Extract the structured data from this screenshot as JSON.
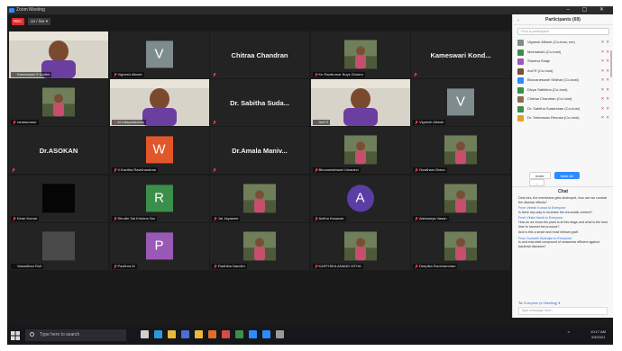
{
  "window": {
    "title": "Zoom Meeting",
    "buttons": "– ▢ ✕"
  },
  "topbar": {
    "rec_label": "REC",
    "meeting_label": "on / live ▾"
  },
  "tiles": [
    {
      "name": "Kameswari S Karthe",
      "kind": "video",
      "muted": false
    },
    {
      "name": "Vignesh Alkesh",
      "kind": "letter",
      "letter": "V",
      "color": "#7f8c8d",
      "muted": true
    },
    {
      "name": "Chitraa Chandran",
      "kind": "bigname",
      "muted": true
    },
    {
      "name": "Kn Ravikumar Boys Dhubro",
      "kind": "photo",
      "muted": true
    },
    {
      "name": "Kameswari Kond...",
      "kind": "bigname",
      "muted": true
    },
    {
      "name": "ranasuranur",
      "kind": "photo",
      "muted": true
    },
    {
      "name": "M.Udayalakshmi",
      "kind": "video",
      "muted": true
    },
    {
      "name": "Dr. Sabitha Suda...",
      "kind": "bigname",
      "muted": true
    },
    {
      "name": "Anil R",
      "kind": "video",
      "muted": false,
      "active": true
    },
    {
      "name": "Vignesh Alkesh",
      "kind": "letter",
      "letter": "V",
      "color": "#7f8c8d",
      "muted": true
    },
    {
      "name": "Dr.ASOKAN",
      "kind": "bigname",
      "muted": true
    },
    {
      "name": "V.Kavitha Ravichandran",
      "kind": "letter",
      "letter": "W",
      "color": "#e2572a",
      "muted": true
    },
    {
      "name": "Dr.Amala Maniv...",
      "kind": "bigname",
      "muted": true
    },
    {
      "name": "Bhuvaneshwari Umadevi",
      "kind": "photo",
      "muted": true
    },
    {
      "name": "Gowtham Bravo",
      "kind": "photo",
      "muted": true
    },
    {
      "name": "Kiran Kumar",
      "kind": "black",
      "muted": true
    },
    {
      "name": "Shruthi Sai Krishna Sai",
      "kind": "letter",
      "letter": "R",
      "color": "#3b8f4a",
      "muted": true
    },
    {
      "name": "Jai Jayasree",
      "kind": "photo",
      "muted": true
    },
    {
      "name": "Anitha Kesavan",
      "kind": "letter-circ",
      "letter": "A",
      "color": "#5b3ea3",
      "muted": true
    },
    {
      "name": "Aishwarya Vasan",
      "kind": "photo",
      "muted": true
    },
    {
      "name": "Vasanthan Ruil",
      "kind": "gray",
      "muted": false
    },
    {
      "name": "Pavithra M",
      "kind": "letter",
      "letter": "P",
      "color": "#9a59b5",
      "muted": true
    },
    {
      "name": "Radhiha Nandini",
      "kind": "photo",
      "muted": true
    },
    {
      "name": "KARTHIKA ANAND MTHA",
      "kind": "photo",
      "muted": true
    },
    {
      "name": "Deepika Ravichandran",
      "kind": "photo",
      "muted": true
    }
  ],
  "participants": {
    "title": "Participants (69)",
    "search_placeholder": "Find a participant",
    "rows": [
      {
        "name": "Vignesh Alkesh (Co-host, me)",
        "color": "#7f8c8d"
      },
      {
        "name": "Meenakshi (Co-host)",
        "color": "#3b8f4a"
      },
      {
        "name": "Sheeba Shaje",
        "color": "#9a59b5"
      },
      {
        "name": "Anil R (Co-host)",
        "color": "#7a5230"
      },
      {
        "name": "Bhuvaneswari Sridhar (Co-host)",
        "color": "#2d8cff"
      },
      {
        "name": "Divya Sathikha (Co-host)",
        "color": "#3b8f4a"
      },
      {
        "name": "Chitraa Chandran (Co-host)",
        "color": "#8c6d4f"
      },
      {
        "name": "Dr. Sabitha Sudarshan (Co-host)",
        "color": "#3b8f4a"
      },
      {
        "name": "Dr. Srinivasan Renuka (Co-host)",
        "color": "#e2a02a"
      }
    ],
    "buttons": {
      "invite": "Invite",
      "mute_all": "Mute All",
      "more": "..."
    }
  },
  "chat": {
    "title": "Chat",
    "messages": [
      {
        "from": "",
        "text": "Dear sirs, the membrane gets destroyed, how can we combat the disease effects?"
      },
      {
        "from": "From Vinesh Kumar to Everyone:",
        "text": "Is there any way to increase the chromatic content?"
      },
      {
        "from": "From Vinita Nandi to Everyone:",
        "text": "How do we know the plant is at this stage and what is the best time to harvest the produce?"
      },
      {
        "from": "",
        "text": "And is this a smart and most brilliant graft."
      },
      {
        "from": "From Sumathi Sivarajan to Everyone:",
        "text": "Is anti-microbial compound of seaweeds efficient against bacterial diseases?"
      }
    ],
    "to_label": "To:",
    "to_value": "Everyone (in Meeting) ▾",
    "input_placeholder": "Type message here..."
  },
  "taskbar": {
    "search_placeholder": "Type here to search",
    "time": "10:17 AM",
    "date": "3/3/2021",
    "icons": [
      {
        "name": "task-view-icon",
        "color": "#cfcfcf"
      },
      {
        "name": "edge-icon",
        "color": "#2b9ad8"
      },
      {
        "name": "file-explorer-icon",
        "color": "#e8b93a"
      },
      {
        "name": "store-icon",
        "color": "#4a6fd2"
      },
      {
        "name": "chrome-icon",
        "color": "#e8b93a"
      },
      {
        "name": "firefox-icon",
        "color": "#e06e2a"
      },
      {
        "name": "media-icon",
        "color": "#d94a4a"
      },
      {
        "name": "photos-icon",
        "color": "#3b8f4a"
      },
      {
        "name": "mail-icon",
        "color": "#2d8cff"
      },
      {
        "name": "zoom-icon",
        "color": "#2d8cff"
      },
      {
        "name": "settings-icon",
        "color": "#9a9a9a"
      }
    ]
  }
}
